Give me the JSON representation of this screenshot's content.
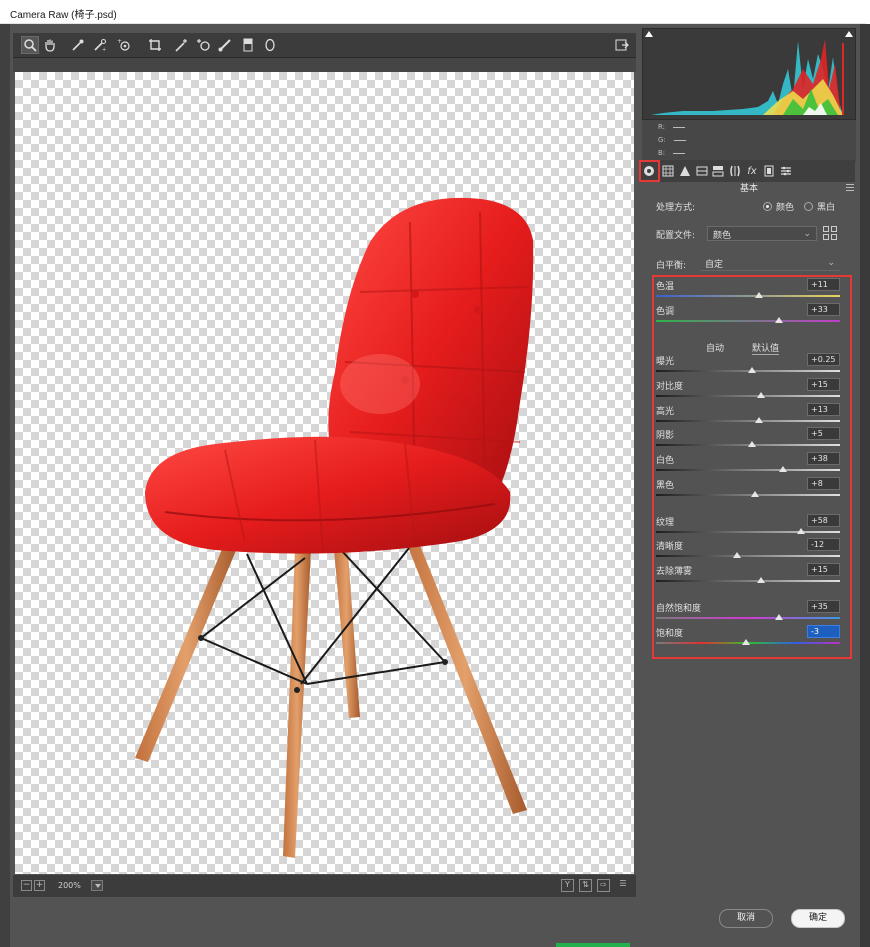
{
  "window": {
    "title": "Camera Raw (椅子.psd)"
  },
  "toolbar": {
    "tools": [
      "zoom-icon",
      "hand-icon",
      "white-balance-icon",
      "color-sampler-icon",
      "target-adjust-icon",
      "crop-icon",
      "straighten-icon",
      "spot-removal-icon",
      "red-eye-icon",
      "adjustment-brush-icon",
      "graduated-filter-icon",
      "radial-filter-icon"
    ],
    "right_icon": "open-preferences-icon"
  },
  "status": {
    "zoom": "200%"
  },
  "histogram": {
    "r_label": "R:",
    "g_label": "G:",
    "b_label": "B:"
  },
  "panel": {
    "title": "基本",
    "treatment_label": "处理方式:",
    "color_option": "颜色",
    "bw_option": "黑白",
    "treatment_selected": "color",
    "profile_label": "配置文件:",
    "profile_value": "颜色",
    "wb_label": "白平衡:",
    "wb_value": "自定",
    "auto_label": "自动",
    "default_label": "默认值"
  },
  "sliders": [
    {
      "key": "temp",
      "label": "色温",
      "value": "+11",
      "pos": 0.56,
      "gradient": "linear-gradient(90deg,#3a5fcd,#e8d35a)"
    },
    {
      "key": "tint",
      "label": "色调",
      "value": "+33",
      "pos": 0.67,
      "gradient": "linear-gradient(90deg,#2fb24a,#c23dc9)"
    },
    {
      "key": "exposure",
      "label": "曝光",
      "value": "+0.25",
      "pos": 0.52,
      "gradient": "linear-gradient(90deg,#1e1e1e,#e0e0e0)"
    },
    {
      "key": "contrast",
      "label": "对比度",
      "value": "+15",
      "pos": 0.57,
      "gradient": "linear-gradient(90deg,#1e1e1e,#e0e0e0)"
    },
    {
      "key": "highlights",
      "label": "高光",
      "value": "+13",
      "pos": 0.56,
      "gradient": "linear-gradient(90deg,#1e1e1e,#e0e0e0)"
    },
    {
      "key": "shadows",
      "label": "阴影",
      "value": "+5",
      "pos": 0.52,
      "gradient": "linear-gradient(90deg,#1e1e1e,#e0e0e0)"
    },
    {
      "key": "whites",
      "label": "白色",
      "value": "+38",
      "pos": 0.69,
      "gradient": "linear-gradient(90deg,#1e1e1e,#e0e0e0)"
    },
    {
      "key": "blacks",
      "label": "黑色",
      "value": "+8",
      "pos": 0.54,
      "gradient": "linear-gradient(90deg,#1e1e1e,#e0e0e0)"
    },
    {
      "key": "texture",
      "label": "纹理",
      "value": "+58",
      "pos": 0.79,
      "gradient": "linear-gradient(90deg,#1e1e1e,#e0e0e0)"
    },
    {
      "key": "clarity",
      "label": "清晰度",
      "value": "-12",
      "pos": 0.44,
      "gradient": "linear-gradient(90deg,#1e1e1e,#e0e0e0)"
    },
    {
      "key": "dehaze",
      "label": "去除薄雾",
      "value": "+15",
      "pos": 0.57,
      "gradient": "linear-gradient(90deg,#1e1e1e,#e0e0e0)"
    },
    {
      "key": "vibrance",
      "label": "自然饱和度",
      "value": "+35",
      "pos": 0.67,
      "gradient": "linear-gradient(90deg,#7a7a7a,#d23ad2,#3a9adf)"
    },
    {
      "key": "saturation",
      "label": "饱和度",
      "value": "-3",
      "pos": 0.49,
      "gradient": "linear-gradient(90deg,#7a7a7a,#e03030,#30c030,#3060e0,#c030c0)"
    }
  ],
  "buttons": {
    "cancel": "取消",
    "ok": "确定"
  },
  "colors": {
    "panel_bg": "#535353",
    "highlight": "#e53935",
    "selection": "#1d5fbf"
  }
}
